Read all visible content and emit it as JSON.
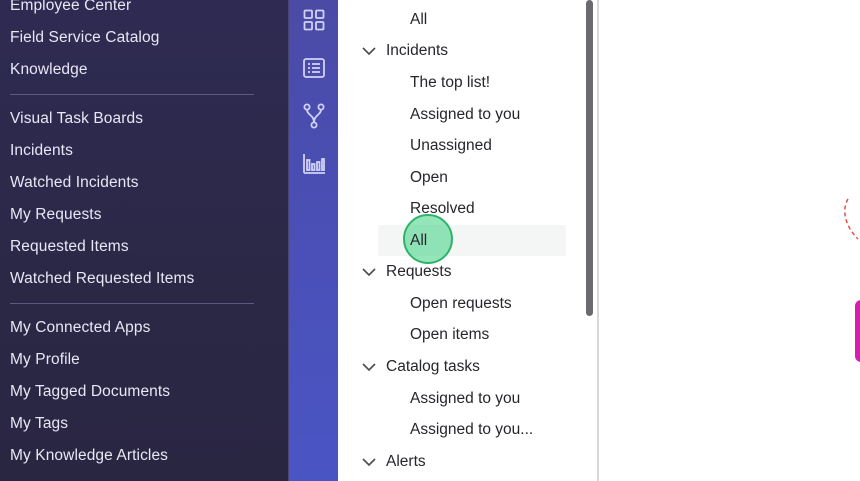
{
  "left_nav": {
    "items": [
      {
        "label": "Employee Center"
      },
      {
        "label": "Field Service Catalog"
      },
      {
        "label": "Knowledge"
      },
      {
        "label": "Visual Task Boards"
      },
      {
        "label": "Incidents"
      },
      {
        "label": "Watched Incidents"
      },
      {
        "label": "My Requests"
      },
      {
        "label": "Requested Items"
      },
      {
        "label": "Watched Requested Items"
      },
      {
        "label": "My Connected Apps"
      },
      {
        "label": "My Profile"
      },
      {
        "label": "My Tagged Documents"
      },
      {
        "label": "My Tags"
      },
      {
        "label": "My Knowledge Articles"
      }
    ]
  },
  "icon_rail": {
    "icons": [
      "grid-icon",
      "list-icon",
      "workflow-icon",
      "bar-chart-icon"
    ]
  },
  "tree": {
    "top_item": "All",
    "groups": [
      {
        "label": "Incidents",
        "children": [
          "The top list!",
          "Assigned to you",
          "Unassigned",
          "Open",
          "Resolved",
          "All"
        ]
      },
      {
        "label": "Requests",
        "children": [
          "Open requests",
          "Open items"
        ]
      },
      {
        "label": "Catalog tasks",
        "children": [
          "Assigned to you",
          "Assigned to you..."
        ]
      },
      {
        "label": "Alerts",
        "children": []
      }
    ],
    "selected": "Incidents / All"
  },
  "colors": {
    "nav_bg": "#2b2846",
    "rail_bg": "#4a52bc",
    "click_marker": "#2eb36a",
    "accent_magenta": "#d61fae"
  }
}
